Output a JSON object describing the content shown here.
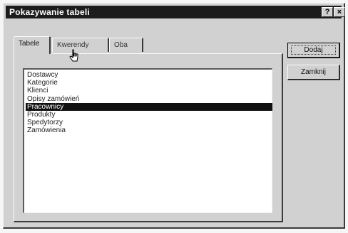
{
  "window": {
    "title": "Pokazywanie tabeli",
    "help_label": "?",
    "close_label": "×"
  },
  "tabs": [
    {
      "label": "Tabele",
      "active": true
    },
    {
      "label": "Kwerendy",
      "active": false
    },
    {
      "label": "Oba",
      "active": false
    }
  ],
  "tables": [
    "Dostawcy",
    "Kategorie",
    "Klienci",
    "Opisy zamówień",
    "Pracownicy",
    "Produkty",
    "Spedytorzy",
    "Zamówienia"
  ],
  "selected_table": "Pracownicy",
  "buttons": {
    "add": "Dodaj",
    "close": "Zamknij"
  },
  "colors": {
    "titlebar": "#1c1c1c",
    "dialog": "#d1d1d1",
    "selection": "#111111"
  }
}
